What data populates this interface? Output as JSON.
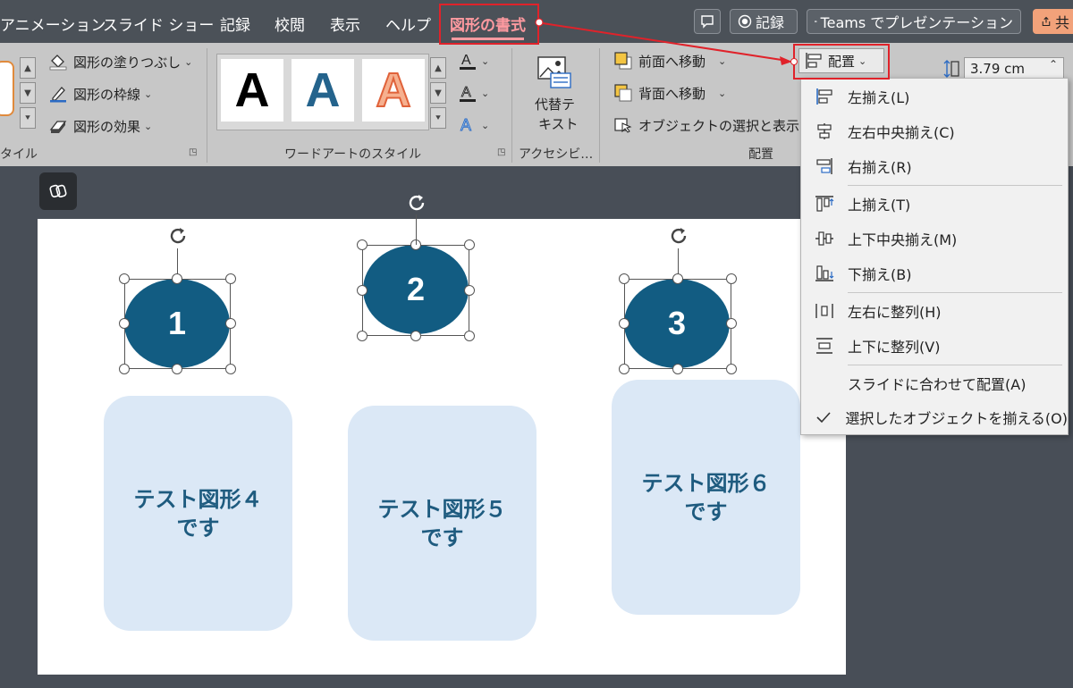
{
  "tabs": [
    {
      "label": "アニメーション"
    },
    {
      "label": "スライド ショー"
    },
    {
      "label": "記録"
    },
    {
      "label": "校閲"
    },
    {
      "label": "表示"
    },
    {
      "label": "ヘルプ"
    },
    {
      "label": "図形の書式"
    }
  ],
  "top_buttons": {
    "record": "記録",
    "teams": "Teams でプレゼンテーション",
    "share": "共"
  },
  "ribbon": {
    "shape_styles": {
      "fill": "図形の塗りつぶし",
      "outline": "図形の枠線",
      "effects": "図形の効果",
      "group_label": "タイル"
    },
    "wordart": {
      "letters": [
        "A",
        "A",
        "A"
      ],
      "group_label": "ワードアートのスタイル"
    },
    "accessibility": {
      "alt_text_line1": "代替テ",
      "alt_text_line2": "キスト",
      "group_label": "アクセシビ…"
    },
    "arrange": {
      "bring_forward": "前面へ移動",
      "send_backward": "背面へ移動",
      "selection_pane": "オブジェクトの選択と表示",
      "align": "配置",
      "group_label": "配置"
    },
    "size": {
      "height_value": "3.79 cm"
    }
  },
  "align_menu": {
    "items": [
      {
        "label": "左揃え(L)",
        "icon": "align-left-icon"
      },
      {
        "label": "左右中央揃え(C)",
        "icon": "align-center-icon"
      },
      {
        "label": "右揃え(R)",
        "icon": "align-right-icon"
      },
      {
        "label": "上揃え(T)",
        "icon": "align-top-icon"
      },
      {
        "label": "上下中央揃え(M)",
        "icon": "align-middle-icon"
      },
      {
        "label": "下揃え(B)",
        "icon": "align-bottom-icon"
      },
      {
        "label": "左右に整列(H)",
        "icon": "distribute-horizontal-icon"
      },
      {
        "label": "上下に整列(V)",
        "icon": "distribute-vertical-icon"
      },
      {
        "label": "スライドに合わせて配置(A)",
        "icon": ""
      },
      {
        "label": "選択したオブジェクトを揃える(O)",
        "icon": "checkmark-icon"
      }
    ]
  },
  "slide": {
    "circles": [
      {
        "label": "1"
      },
      {
        "label": "2"
      },
      {
        "label": "3"
      }
    ],
    "rects": [
      {
        "line1": "テスト図形４",
        "line2": "です"
      },
      {
        "line1": "テスト図形５",
        "line2": "です"
      },
      {
        "line1": "テスト図形６",
        "line2": "です"
      }
    ]
  },
  "colors": {
    "accent_red": "#e0222a",
    "shape_blue": "#125c82",
    "rect_fill": "#dbe8f6"
  }
}
